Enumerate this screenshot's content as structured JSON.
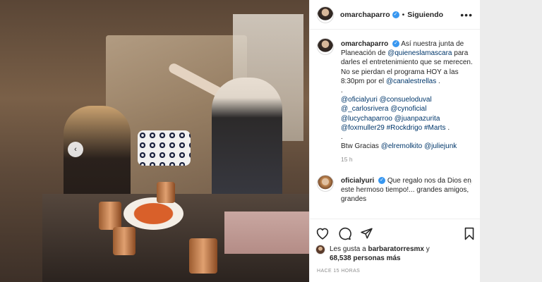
{
  "post_author": {
    "username": "omarchaparro",
    "verified_symbol": "✓",
    "separator": "•",
    "follow_status": "Siguiendo",
    "more_symbol": "•••"
  },
  "caption": {
    "username": "omarchaparro",
    "line1_text": "Así nuestra junta de Planeación de",
    "mention_main": "@quieneslamascara",
    "line2_text": "para darles el entretenimiento que se merecen. No se pierdan el programa HOY a las 8:30pm por el",
    "mention_channel": "@canalestrellas",
    "line2_end": " .",
    "dot_line": ".",
    "mentions": [
      "@oficialyuri",
      "@consueloduval",
      "@_carlosrivera",
      "@cynoficial",
      "@lucychaparroo",
      "@juanpazurita",
      "@foxmuller29",
      "#Rockdrigo",
      "#Marts"
    ],
    "mentions_end": " .",
    "dot_line2": ".",
    "btw_text": "Btw Gracias",
    "btw_mentions": [
      "@elremolkito",
      "@juliejunk"
    ],
    "time": "15 h"
  },
  "comment": {
    "username": "oficialyuri",
    "verified_symbol": "✓",
    "text": "Que regalo nos da Dios en este hermoso tiempo!... grandes amigos, grandes"
  },
  "likes": {
    "prefix": "Les gusta a",
    "user": "barbaratorresmx",
    "connector": "y",
    "count": "68,538 personas más"
  },
  "time_ago": "HACE 15 HORAS",
  "media": {
    "prev_arrow": "‹"
  }
}
